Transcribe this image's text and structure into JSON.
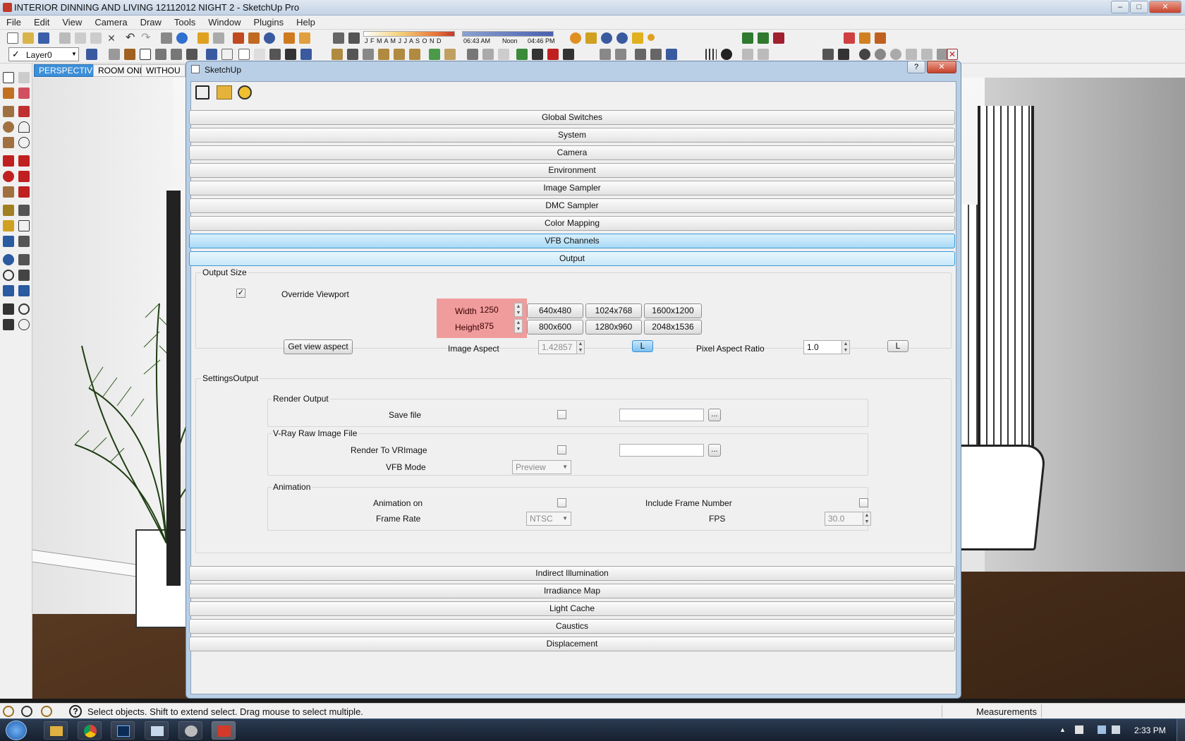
{
  "window": {
    "title": "INTERIOR DINNING AND LIVING 12112012 NIGHT 2 - SketchUp Pro",
    "min": "–",
    "max": "□",
    "close": "✕"
  },
  "menu": [
    "File",
    "Edit",
    "View",
    "Camera",
    "Draw",
    "Tools",
    "Window",
    "Plugins",
    "Help"
  ],
  "toolbar": {
    "layer": "Layer0",
    "months": "J  F  M  A  M  J  J  A  S  O  N  D",
    "time_start": "06:43 AM",
    "time_mid": "Noon",
    "time_end": "04:46 PM"
  },
  "scene_tabs": [
    "PERSPECTIVE",
    "ROOM ONLY",
    "WITHOU"
  ],
  "dialog": {
    "title": "SketchUp",
    "help": "?",
    "close": "✕",
    "sections_top": [
      "Global Switches",
      "System",
      "Camera",
      "Environment",
      "Image Sampler",
      "DMC Sampler",
      "Color Mapping",
      "VFB Channels",
      "Output"
    ],
    "output_size": {
      "group_label": "Output Size",
      "override_label": "Override Viewport",
      "override_checked": "✓",
      "width_label": "Width",
      "width_value": "1250",
      "height_label": "Height",
      "height_value": "875",
      "presets": [
        "640x480",
        "1024x768",
        "1600x1200",
        "800x600",
        "1280x960",
        "2048x1536"
      ],
      "get_view_aspect": "Get view aspect",
      "image_aspect_label": "Image Aspect",
      "image_aspect_value": "1.42857",
      "lock1": "L",
      "pixel_aspect_label": "Pixel Aspect Ratio",
      "pixel_aspect_value": "1.0",
      "lock2": "L"
    },
    "settings_output": {
      "group_label": "SettingsOutput",
      "render_output_label": "Render Output",
      "save_file_label": "Save file",
      "vray_raw_label": "V-Ray Raw Image File",
      "render_to_vrimage_label": "Render To VRImage",
      "vfb_mode_label": "VFB Mode",
      "vfb_mode_value": "Preview",
      "animation_label": "Animation",
      "animation_on_label": "Animation on",
      "include_frame_label": "Include Frame Number",
      "frame_rate_label": "Frame Rate",
      "frame_rate_value": "NTSC",
      "fps_label": "FPS",
      "fps_value": "30.0",
      "browse": "..."
    },
    "sections_bottom": [
      "Indirect Illumination",
      "Irradiance Map",
      "Light Cache",
      "Caustics",
      "Displacement"
    ]
  },
  "status": {
    "text": "Select objects. Shift to extend select. Drag mouse to select multiple.",
    "measurements": "Measurements"
  },
  "taskbar": {
    "clock": "2:33 PM"
  },
  "colors": {
    "highlight_box": "#f08080",
    "section_selected": "#3c9ad8",
    "scene_tab_active": "#3c8fd8"
  }
}
